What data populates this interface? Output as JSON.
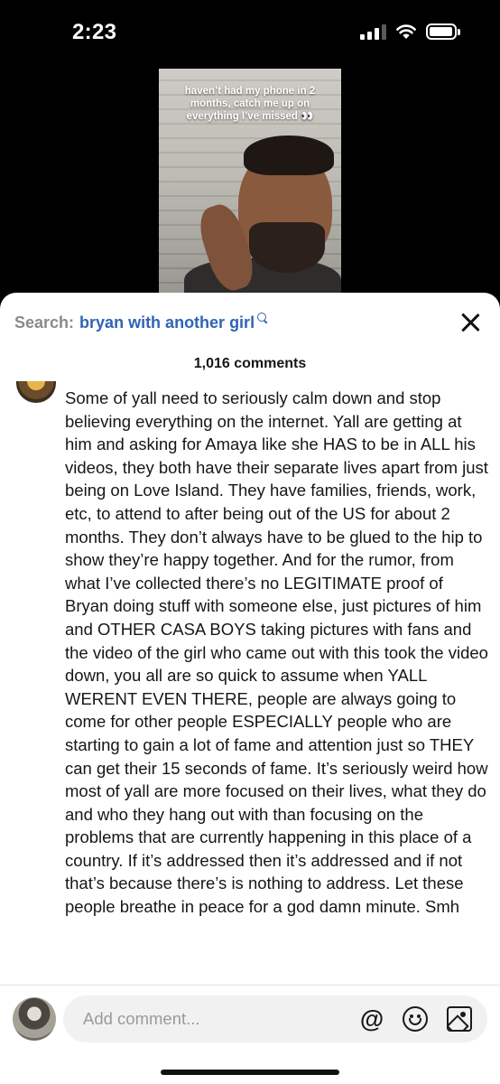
{
  "status_bar": {
    "time": "2:23",
    "signal_bars": 3,
    "battery_level": 0.95,
    "icons": [
      "cellular-signal-icon",
      "wifi-icon",
      "battery-icon"
    ]
  },
  "video": {
    "caption": "haven’t had my phone in 2 months, catch me up on everything I’ve missed 👀"
  },
  "search": {
    "label": "Search:",
    "query": "bryan with another girl"
  },
  "comments_header": {
    "count_text": "1,016 comments"
  },
  "comment": {
    "text": "Some of yall need to seriously calm down and stop believing everything on the internet. Yall are getting at him and asking for Amaya like she HAS to be in ALL his videos, they both have their separate lives apart from just being on Love Island. They have families, friends, work, etc, to attend to after being out of the US for about 2 months. They don’t always have to be glued to the hip to show they’re happy together. And for the rumor, from what I’ve collected there’s no LEGITIMATE proof of Bryan doing stuff with someone else, just pictures of him and OTHER CASA BOYS taking pictures with fans and the video of the girl who came out with this took the video down, you all are so quick to assume when YALL WERENT EVEN THERE, people are always going to come for other people ESPECIALLY people who are starting to gain a lot of fame and attention just so THEY can get their 15 seconds of fame. It’s seriously weird how most of yall are more focused on their lives, what they do and who they hang out with than focusing on the problems that are currently happening in this place of a country. If it’s addressed then it’s addressed and if not that’s because there’s is nothing to address. Let these people breathe in peace for a god damn minute. Smh"
  },
  "composer": {
    "placeholder": "Add comment...",
    "mention_symbol": "@"
  },
  "colors": {
    "accent_link": "#2f63b5",
    "sheet_bg": "#ffffff",
    "input_bg": "#f1f1f2",
    "muted_text": "#8a8a8a"
  }
}
